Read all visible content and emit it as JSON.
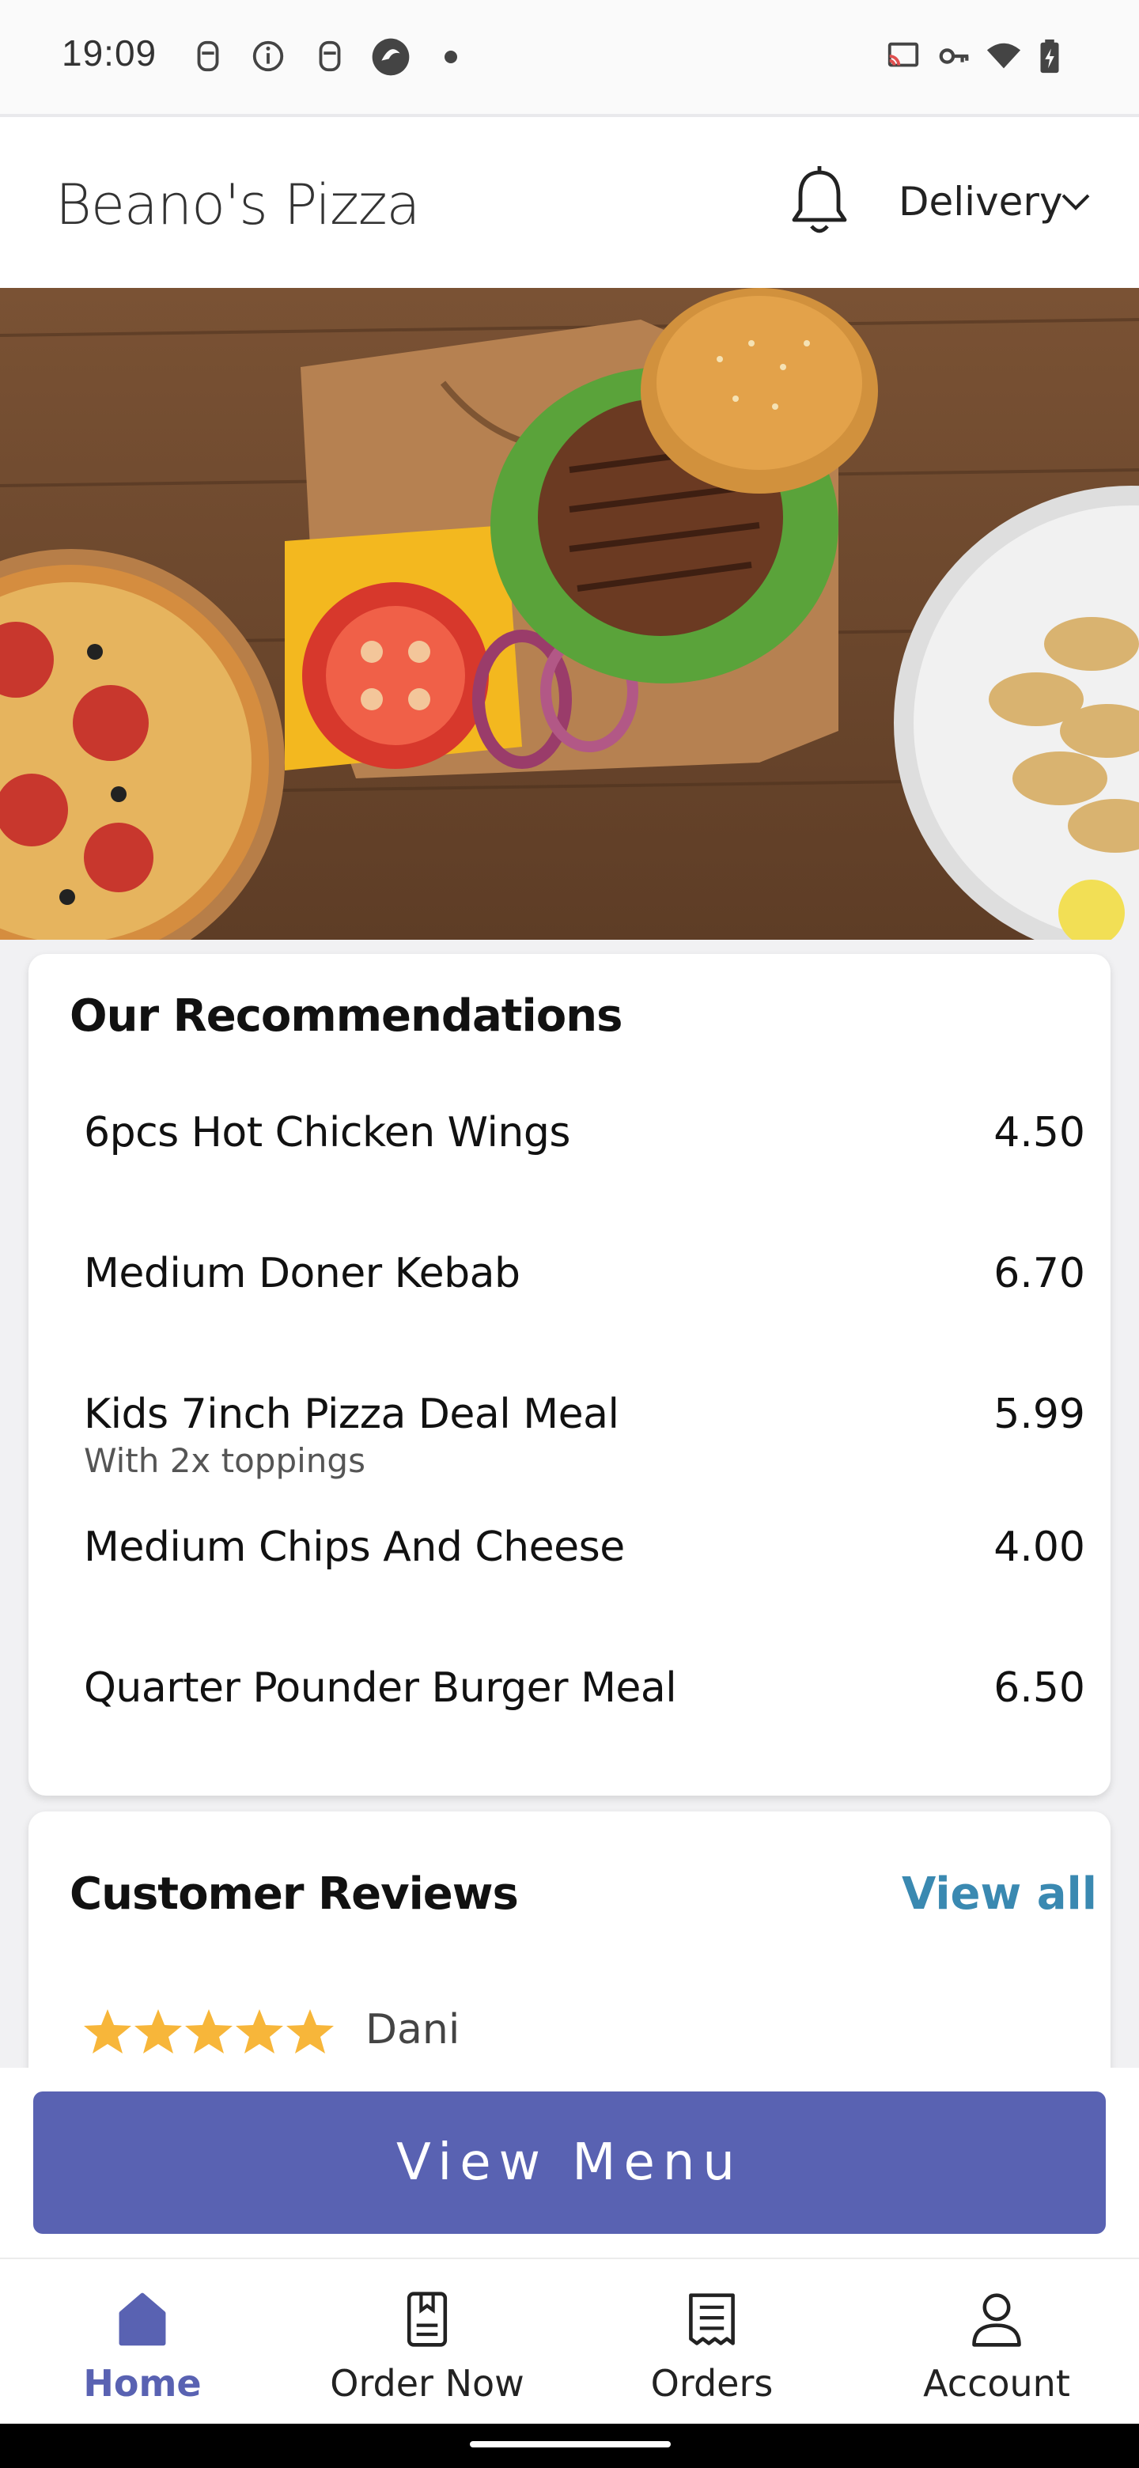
{
  "status_bar": {
    "time": "19:09",
    "left_icons": [
      "notification-icon",
      "info-icon",
      "notification-icon",
      "browser-icon",
      "dot-icon"
    ],
    "right_icons": [
      "cast-icon",
      "vpn-key-icon",
      "wifi-icon",
      "battery-charging-icon"
    ]
  },
  "header": {
    "brand": "Beano's Pizza",
    "bell_icon": "bell-icon",
    "order_mode": "Delivery",
    "chevron_icon": "chevron-down-icon"
  },
  "hero": {
    "image": "food-banner-pizza-burger-kebab"
  },
  "recommendations": {
    "title": "Our Recommendations",
    "items": [
      {
        "name": "6pcs Hot Chicken Wings",
        "subtitle": "",
        "price": "4.50"
      },
      {
        "name": "Medium Doner Kebab",
        "subtitle": "",
        "price": "6.70"
      },
      {
        "name": "Kids 7inch Pizza Deal Meal",
        "subtitle": "With 2x toppings",
        "price": "5.99"
      },
      {
        "name": "Medium Chips And Cheese",
        "subtitle": "",
        "price": "4.00"
      },
      {
        "name": "Quarter Pounder Burger Meal",
        "subtitle": "",
        "price": "6.50"
      }
    ]
  },
  "reviews": {
    "title": "Customer Reviews",
    "view_all": "View all",
    "first_review": {
      "rating": 5,
      "max_rating": 5,
      "name": "Dani"
    },
    "star_color": "#f7b63a"
  },
  "cta": {
    "label": "View Menu",
    "color": "#5962b2"
  },
  "nav": {
    "items": [
      {
        "label": "Home",
        "icon": "home-icon",
        "active": true
      },
      {
        "label": "Order Now",
        "icon": "menu-book-icon",
        "active": false
      },
      {
        "label": "Orders",
        "icon": "receipt-icon",
        "active": false
      },
      {
        "label": "Account",
        "icon": "user-icon",
        "active": false
      }
    ],
    "active_color": "#5962b2"
  },
  "colors": {
    "link": "#3a89b1",
    "accent": "#5962b2"
  }
}
